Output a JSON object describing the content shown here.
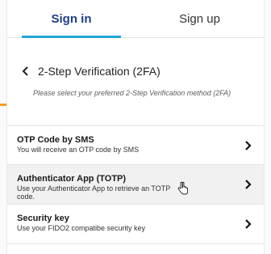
{
  "tabs": {
    "signin": "Sign in",
    "signup": "Sign up"
  },
  "back": {
    "title": "2-Step Verification (2FA)"
  },
  "instructions": "Please select your preferred 2-Step Verification method (2FA)",
  "options": [
    {
      "title": "OTP Code by SMS",
      "desc": "You will receive an OTP code by SMS"
    },
    {
      "title": "Authenticator App (TOTP)",
      "desc": "Use your Authenticator App to retrieve an TOTP code."
    },
    {
      "title": "Security key",
      "desc": "Use your FIDO2 compatibe security key"
    }
  ],
  "colors": {
    "accent": "#23a5d9",
    "brand": "#1f3c88",
    "orange": "#f29e1c"
  },
  "icons": {
    "back": "chevron-left-icon",
    "option": "chevron-right-icon",
    "cursor": "hand-pointer-icon"
  }
}
